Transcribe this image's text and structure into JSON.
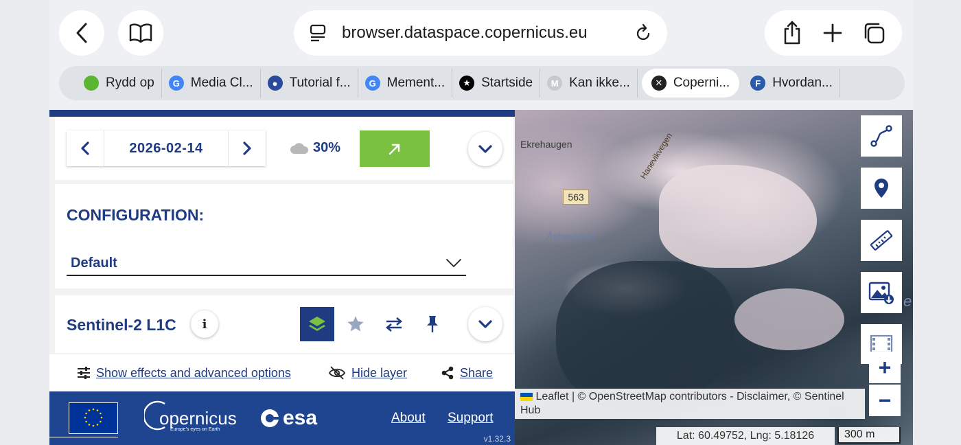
{
  "browser": {
    "url": "browser.dataspace.copernicus.eu",
    "tabs": [
      {
        "label": "Rydd op",
        "favicon_color": "#5cb531",
        "favicon_letter": ""
      },
      {
        "label": "Media Cl...",
        "favicon_color": "#4285f4",
        "favicon_letter": "G"
      },
      {
        "label": "Tutorial f...",
        "favicon_color": "#2a4a9b",
        "favicon_letter": "●"
      },
      {
        "label": "Mement...",
        "favicon_color": "#4285f4",
        "favicon_letter": "G"
      },
      {
        "label": "Startside",
        "favicon_color": "#000000",
        "favicon_letter": "★"
      },
      {
        "label": "Kan ikke...",
        "favicon_color": "#c9c9d2",
        "favicon_letter": "M"
      },
      {
        "label": "Coperni...",
        "favicon_color": "#222222",
        "favicon_letter": "✕",
        "active": true
      },
      {
        "label": "Hvordan...",
        "favicon_color": "#2a5aa8",
        "favicon_letter": "F"
      }
    ]
  },
  "panel": {
    "date": "2026-02-14",
    "cloud_cover": "30%",
    "config_title": "CONFIGURATION:",
    "config_value": "Default",
    "layer_title": "Sentinel-2 L1C",
    "info_glyph": "i",
    "actions": {
      "effects": "Show effects and advanced options",
      "hide": "Hide layer",
      "share": "Share"
    }
  },
  "footer": {
    "copernicus": "opernicus",
    "copernicus_tag": "Europe's eyes on Earth",
    "esa": "esa",
    "about": "About",
    "support": "Support",
    "version": "v1.32.3"
  },
  "map": {
    "labels": {
      "ekrehaugen": "Ekrehaugen",
      "hanevikvegen": "Hanevikvegen",
      "road": "563",
      "asbovatnet": "Åsbøvatnet",
      "edge": "e"
    },
    "attribution_leaflet": "Leaflet",
    "attribution_rest": " | © OpenStreetMap contributors - Disclaimer, © Sentinel Hub",
    "coords": "Lat: 60.49752, Lng: 5.18126",
    "scale": "300 m",
    "zoom_in": "+",
    "zoom_out": "−"
  },
  "colors": {
    "brand_blue": "#1f3b82",
    "accent_green": "#7ac142",
    "footer_blue": "#1f4591"
  }
}
